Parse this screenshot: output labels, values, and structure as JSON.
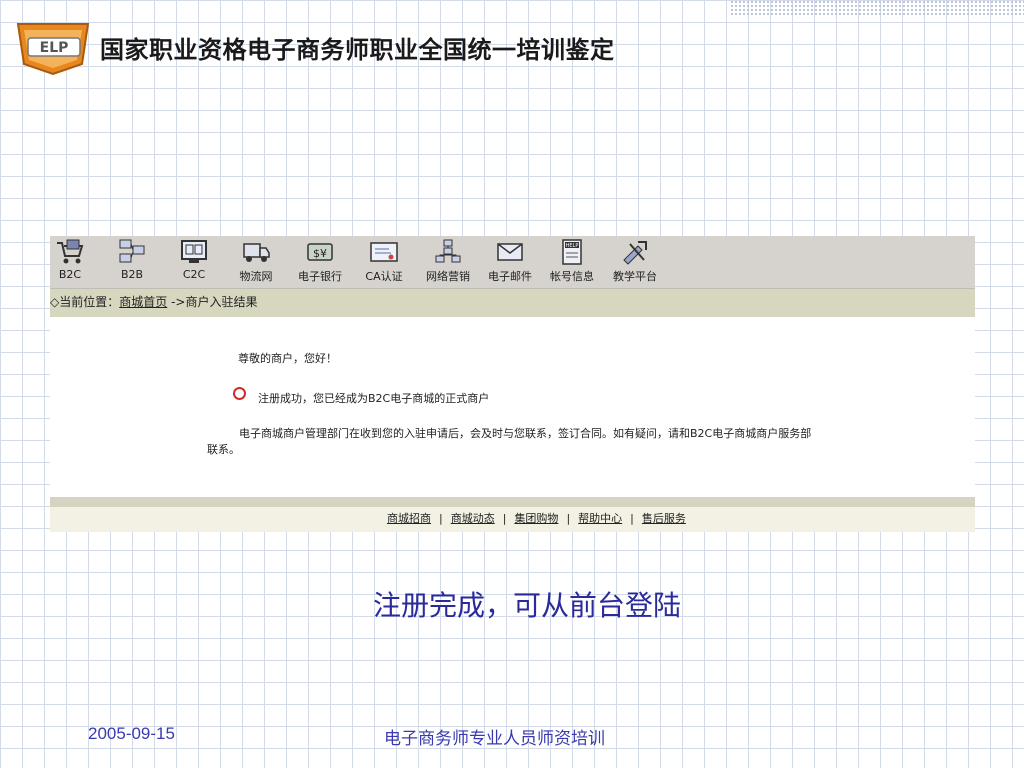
{
  "slide": {
    "logo_text": "ELP",
    "header_title": "国家职业资格电子商务师职业全国统一培训鉴定",
    "caption": "注册完成，可从前台登陆",
    "date": "2005-09-15",
    "footer": "电子商务师专业人员师资培训"
  },
  "toolbar": {
    "items": [
      {
        "label": "B2C",
        "icon": "shopping-cart-icon"
      },
      {
        "label": "B2B",
        "icon": "network-computers-icon"
      },
      {
        "label": "C2C",
        "icon": "computer-icon"
      },
      {
        "label": "物流网",
        "icon": "truck-icon"
      },
      {
        "label": "电子银行",
        "icon": "money-icon"
      },
      {
        "label": "CA认证",
        "icon": "certificate-icon"
      },
      {
        "label": "网络营销",
        "icon": "sitemap-icon"
      },
      {
        "label": "电子邮件",
        "icon": "mail-icon"
      },
      {
        "label": "帐号信息",
        "icon": "help-book-icon"
      },
      {
        "label": "教学平台",
        "icon": "tools-icon"
      }
    ]
  },
  "breadcrumb": {
    "prefix": "◇当前位置：",
    "home": "商城首页",
    "current": " ->商户入驻结果"
  },
  "message": {
    "greeting": "尊敬的商户，您好！",
    "success": "注册成功，您已经成为B2C电子商城的正式商户",
    "body_line1": "电子商城商户管理部门在收到您的入驻申请后，会及时与您联系，签订合同。如有疑问，请和B2C电子商城商户服务部",
    "body_line2": "联系。"
  },
  "footer_links": [
    "商城招商",
    "商城动态",
    "集团购物",
    "帮助中心",
    "售后服务"
  ],
  "colors": {
    "toolbar_bg": "#d6d3ce",
    "breadcrumb_bg": "#d7d6bf",
    "caption": "#2a2a9a",
    "success_marker": "#d02a2a"
  }
}
